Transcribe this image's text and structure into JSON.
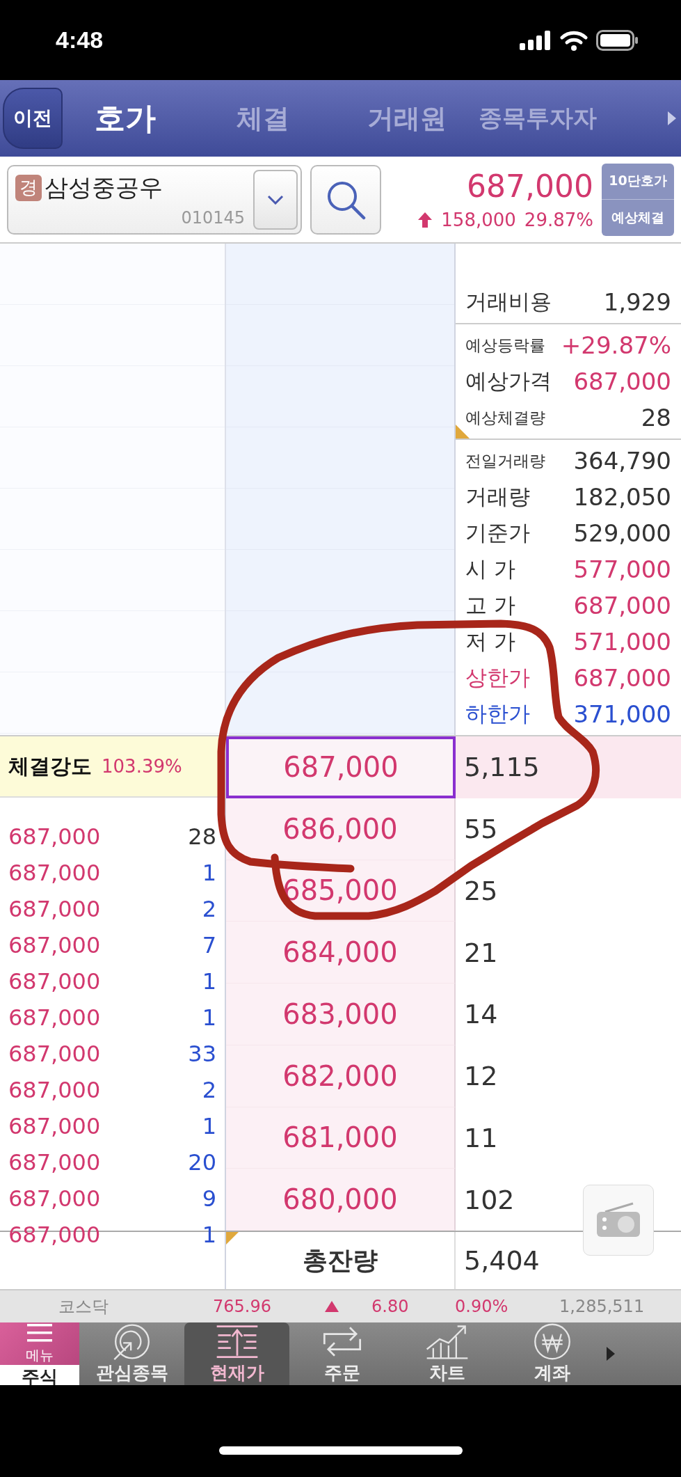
{
  "status_bar": {
    "time": "4:48"
  },
  "header": {
    "back": "이전",
    "tabs": [
      {
        "label": "호가",
        "selected": true
      },
      {
        "label": "체결",
        "selected": false
      },
      {
        "label": "거래원",
        "selected": false
      },
      {
        "label": "종목투자자",
        "selected": false
      }
    ]
  },
  "stock": {
    "badge": "경",
    "name": "삼성중공우",
    "code": "010145",
    "price": "687,000",
    "rising": true,
    "change": "158,000",
    "change_rate": "29.87%",
    "buttons": [
      "10단호가",
      "예상체결"
    ]
  },
  "info": {
    "groups": [
      [
        {
          "label": {
            "text": "거래비용",
            "color": "#333333"
          },
          "value": {
            "text": "1,929",
            "color": "#333333"
          }
        }
      ],
      [
        {
          "label": {
            "text": "예상등락률",
            "color": "#333333"
          },
          "value": {
            "text": "+29.87%",
            "color": "#d2386e"
          }
        },
        {
          "label": {
            "text": "예상가격",
            "color": "#333333"
          },
          "value": {
            "text": "687,000",
            "color": "#d2386e"
          }
        },
        {
          "label": {
            "text": "예상체결량",
            "color": "#333333"
          },
          "value": {
            "text": "28",
            "color": "#333333"
          }
        }
      ],
      [
        {
          "label": {
            "text": "전일거래량",
            "color": "#333333"
          },
          "value": {
            "text": "364,790",
            "color": "#333333"
          }
        },
        {
          "label": {
            "text": "거래량",
            "color": "#333333"
          },
          "value": {
            "text": "182,050",
            "color": "#333333"
          }
        },
        {
          "label": {
            "text": "기준가",
            "color": "#333333"
          },
          "value": {
            "text": "529,000",
            "color": "#333333"
          }
        },
        {
          "label": {
            "text": "시 가",
            "color": "#333333"
          },
          "value": {
            "text": "577,000",
            "color": "#d2386e"
          }
        },
        {
          "label": {
            "text": "고 가",
            "color": "#333333"
          },
          "value": {
            "text": "687,000",
            "color": "#d2386e"
          }
        },
        {
          "label": {
            "text": "저 가",
            "color": "#333333"
          },
          "value": {
            "text": "571,000",
            "color": "#d2386e"
          }
        },
        {
          "label": {
            "text": "상한가",
            "color": "#d2386e"
          },
          "value": {
            "text": "687,000",
            "color": "#d2386e"
          }
        },
        {
          "label": {
            "text": "하한가",
            "color": "#2a4fd0"
          },
          "value": {
            "text": "371,000",
            "color": "#2a4fd0"
          }
        }
      ]
    ]
  },
  "strength": {
    "label": "체결강도",
    "value": "103.39%"
  },
  "ticks": [
    {
      "price": "687,000",
      "volume": {
        "text": "28",
        "color": "#333333"
      }
    },
    {
      "price": "687,000",
      "volume": {
        "text": "1",
        "color": "#2a4fd0"
      }
    },
    {
      "price": "687,000",
      "volume": {
        "text": "2",
        "color": "#2a4fd0"
      }
    },
    {
      "price": "687,000",
      "volume": {
        "text": "7",
        "color": "#2a4fd0"
      }
    },
    {
      "price": "687,000",
      "volume": {
        "text": "1",
        "color": "#2a4fd0"
      }
    },
    {
      "price": "687,000",
      "volume": {
        "text": "1",
        "color": "#2a4fd0"
      }
    },
    {
      "price": "687,000",
      "volume": {
        "text": "33",
        "color": "#2a4fd0"
      }
    },
    {
      "price": "687,000",
      "volume": {
        "text": "2",
        "color": "#2a4fd0"
      }
    },
    {
      "price": "687,000",
      "volume": {
        "text": "1",
        "color": "#2a4fd0"
      }
    },
    {
      "price": "687,000",
      "volume": {
        "text": "20",
        "color": "#2a4fd0"
      }
    },
    {
      "price": "687,000",
      "volume": {
        "text": "9",
        "color": "#2a4fd0"
      }
    },
    {
      "price": "687,000",
      "volume": {
        "text": "1",
        "color": "#2a4fd0"
      }
    }
  ],
  "book": [
    {
      "price": "687,000",
      "quantity": "5,115",
      "selected": true
    },
    {
      "price": "686,000",
      "quantity": "55",
      "selected": false
    },
    {
      "price": "685,000",
      "quantity": "25",
      "selected": false
    },
    {
      "price": "684,000",
      "quantity": "21",
      "selected": false
    },
    {
      "price": "683,000",
      "quantity": "14",
      "selected": false
    },
    {
      "price": "682,000",
      "quantity": "12",
      "selected": false
    },
    {
      "price": "681,000",
      "quantity": "11",
      "selected": false
    },
    {
      "price": "680,000",
      "quantity": "102",
      "selected": false
    }
  ],
  "total": {
    "label": "총잔량",
    "value": "5,404"
  },
  "index_bar": {
    "name": "코스닥",
    "value": "765.96",
    "rising": true,
    "change": "6.80",
    "rate": "0.90%",
    "volume": "1,285,511"
  },
  "nav": {
    "menu": "메뉴",
    "section": "주식",
    "items": [
      {
        "label": "관심종목",
        "kind": "target",
        "selected": false
      },
      {
        "label": "현재가",
        "kind": "ladder",
        "selected": true
      },
      {
        "label": "주문",
        "kind": "repeat",
        "selected": false
      },
      {
        "label": "차트",
        "kind": "chart",
        "selected": false
      },
      {
        "label": "계좌",
        "kind": "won",
        "selected": false
      }
    ]
  }
}
